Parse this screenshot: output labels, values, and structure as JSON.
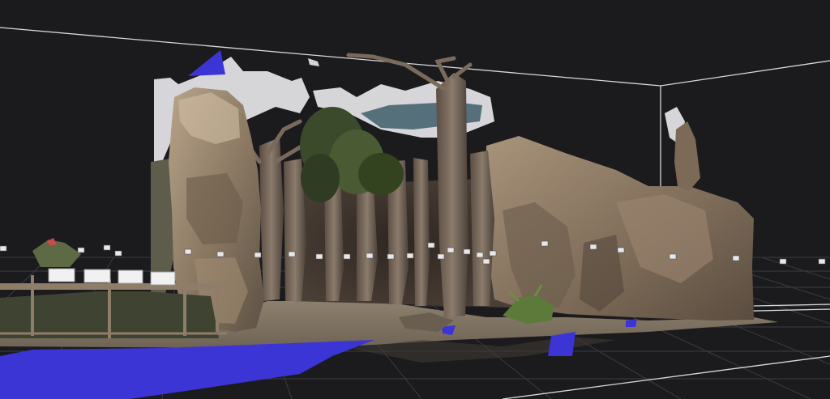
{
  "viewport": {
    "background": "#1b1b1d",
    "grid_color": "#3a3c44",
    "bounding_box_color": "#d9d9d9",
    "camera_marker_color": "#e8e8ea",
    "blue_patch_color": "#3c35d6"
  },
  "scene": {
    "objects": [
      "rock-formation-left",
      "rock-formation-right",
      "tree-trunks",
      "foliage",
      "fence-with-signs",
      "sandy-floor",
      "fern-plant"
    ],
    "sign_count": 4
  }
}
